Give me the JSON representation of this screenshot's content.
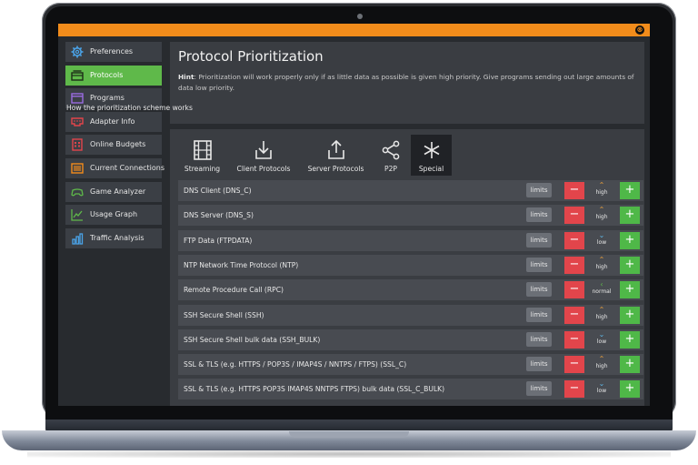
{
  "colors": {
    "accent": "#f28c1b",
    "active_nav": "#5fb94a",
    "minus": "#e2454b",
    "plus": "#4fb848",
    "arrow_up": "#f2a33a",
    "arrow_down": "#5fb7e6",
    "arrow_normal": "#5fb94a"
  },
  "window": {
    "close_glyph": "⊗"
  },
  "sidebar": {
    "items": [
      {
        "label": "Preferences",
        "icon": "gear-icon"
      },
      {
        "label": "Protocols",
        "icon": "protocols-icon",
        "active": true
      },
      {
        "label": "Programs",
        "icon": "window-icon"
      },
      {
        "label": "Adapter Info",
        "icon": "adapter-icon"
      },
      {
        "label": "Online Budgets",
        "icon": "calculator-icon"
      },
      {
        "label": "Current Connections",
        "icon": "connections-icon"
      },
      {
        "label": "Game Analyzer",
        "icon": "gamepad-icon"
      },
      {
        "label": "Usage Graph",
        "icon": "graph-icon"
      },
      {
        "label": "Traffic Analysis",
        "icon": "bar-chart-icon"
      }
    ]
  },
  "header": {
    "title": "Protocol Prioritization",
    "hint_label": "Hint",
    "hint_text": ": Prioritization will work properly only if as little data as possible is given high priority. Give programs sending out large amounts of data low priority.",
    "link": "How the prioritization scheme works"
  },
  "tabs": [
    {
      "label": "Streaming",
      "icon": "film-icon"
    },
    {
      "label": "Client Protocols",
      "icon": "download-icon"
    },
    {
      "label": "Server Protocols",
      "icon": "upload-icon"
    },
    {
      "label": "P2P",
      "icon": "share-icon"
    },
    {
      "label": "Special",
      "icon": "asterisk-icon",
      "active": true
    }
  ],
  "buttons": {
    "limits": "limits",
    "minus": "−",
    "plus": "+"
  },
  "protocols": [
    {
      "name": "DNS Client (DNS_C)",
      "priority": "high"
    },
    {
      "name": "DNS Server (DNS_S)",
      "priority": "high"
    },
    {
      "name": "FTP Data (FTPDATA)",
      "priority": "low"
    },
    {
      "name": "NTP Network Time Protocol (NTP)",
      "priority": "high"
    },
    {
      "name": "Remote Procedure Call (RPC)",
      "priority": "normal"
    },
    {
      "name": "SSH Secure Shell (SSH)",
      "priority": "high"
    },
    {
      "name": "SSH Secure Shell bulk data (SSH_BULK)",
      "priority": "low"
    },
    {
      "name": "SSL & TLS (e.g. HTTPS / POP3S / IMAP4S / NNTPS / FTPS) (SSL_C)",
      "priority": "high"
    },
    {
      "name": "SSL & TLS (e.g. HTTPS POP3S IMAP4S NNTPS FTPS) bulk data (SSL_C_BULK)",
      "priority": "low"
    }
  ]
}
